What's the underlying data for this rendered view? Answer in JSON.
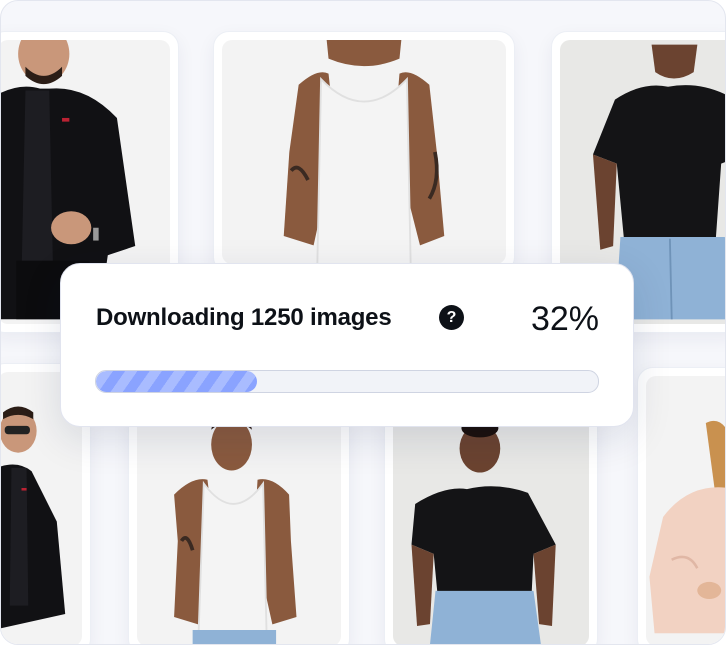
{
  "download": {
    "title": "Downloading 1250 images",
    "help_icon": "question-circle-icon",
    "percent_label": "32%",
    "progress": 0.32
  },
  "gallery": {
    "row1": [
      "man-black-suit",
      "man-white-tank-top",
      "woman-black-tshirt"
    ],
    "row2": [
      "man-black-suit",
      "man-white-tank-top",
      "woman-black-tshirt",
      "woman-peach-blazer"
    ]
  }
}
